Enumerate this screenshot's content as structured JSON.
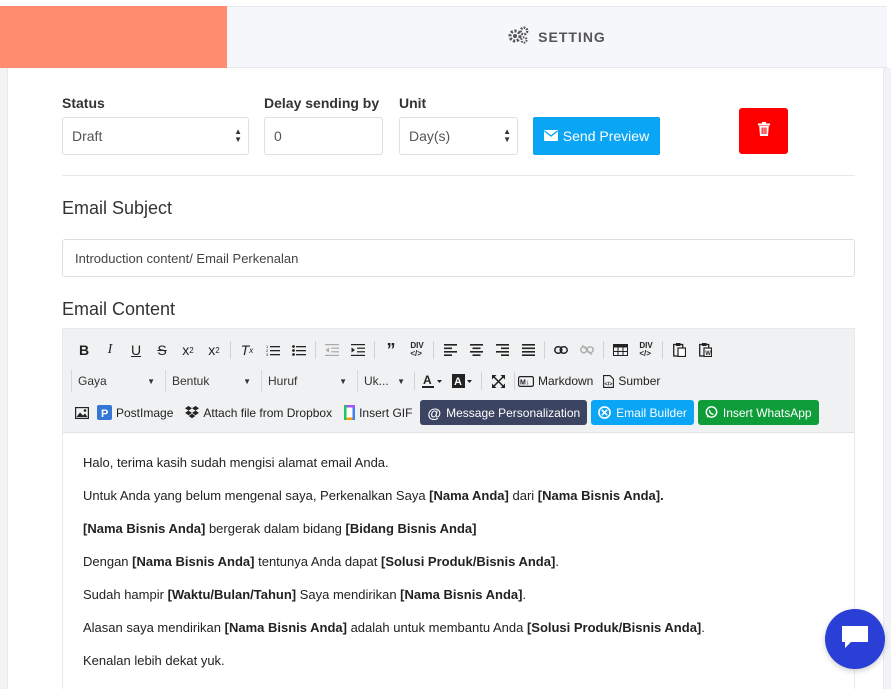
{
  "tabs": {
    "setting_label": "SETTING"
  },
  "form": {
    "status_label": "Status",
    "status_value": "Draft",
    "delay_label": "Delay sending by",
    "delay_value": "0",
    "unit_label": "Unit",
    "unit_value": "Day(s)",
    "send_preview_label": "Send Preview"
  },
  "subject": {
    "title": "Email Subject",
    "value": "Introduction content/ Email Perkenalan"
  },
  "content": {
    "title": "Email Content",
    "toolbar": {
      "gaya": "Gaya",
      "bentuk": "Bentuk",
      "huruf": "Huruf",
      "ukuran": "Uk...",
      "markdown": "Markdown",
      "sumber": "Sumber",
      "postimage": "PostImage",
      "dropbox": "Attach file from Dropbox",
      "insert_gif": "Insert GIF",
      "message_personalization": "Message Personalization",
      "email_builder": "Email Builder",
      "insert_whatsapp": "Insert WhatsApp"
    },
    "body": {
      "p1": "Halo, terima kasih sudah mengisi alamat email Anda.",
      "p2_a": "Untuk Anda yang belum mengenal saya, Perkenalkan Saya ",
      "p2_b": "[Nama Anda]",
      "p2_c": " dari ",
      "p2_d": "[Nama Bisnis Anda].",
      "p3_a": "[Nama Bisnis Anda]",
      "p3_b": " bergerak dalam bidang ",
      "p3_c": "[Bidang Bisnis Anda]",
      "p4_a": "Dengan ",
      "p4_b": "[Nama Bisnis Anda]",
      "p4_c": " tentunya Anda dapat ",
      "p4_d": "[Solusi Produk/Bisnis Anda]",
      "p4_e": ".",
      "p5_a": "Sudah hampir ",
      "p5_b": "[Waktu/Bulan/Tahun]",
      "p5_c": " Saya mendirikan ",
      "p5_d": "[Nama Bisnis Anda]",
      "p5_e": ".",
      "p6_a": "Alasan saya mendirikan ",
      "p6_b": "[Nama Bisnis Anda]",
      "p6_c": " adalah untuk membantu Anda ",
      "p6_d": "[Solusi Produk/Bisnis Anda]",
      "p6_e": ".",
      "p7": "Kenalan lebih dekat yuk."
    }
  },
  "colors": {
    "accent_tab": "#ff8c6f",
    "send_preview": "#0aa5f5",
    "delete": "#ff0000",
    "message_personalization": "#3b4460",
    "email_builder": "#0aa5f5",
    "whatsapp": "#0f9d3a",
    "chat_bubble": "#2a3fd6"
  },
  "icons": {
    "setting": "gears-icon",
    "send_preview": "envelope-icon",
    "delete": "trash-icon",
    "chat": "chat-bubble-icon"
  }
}
